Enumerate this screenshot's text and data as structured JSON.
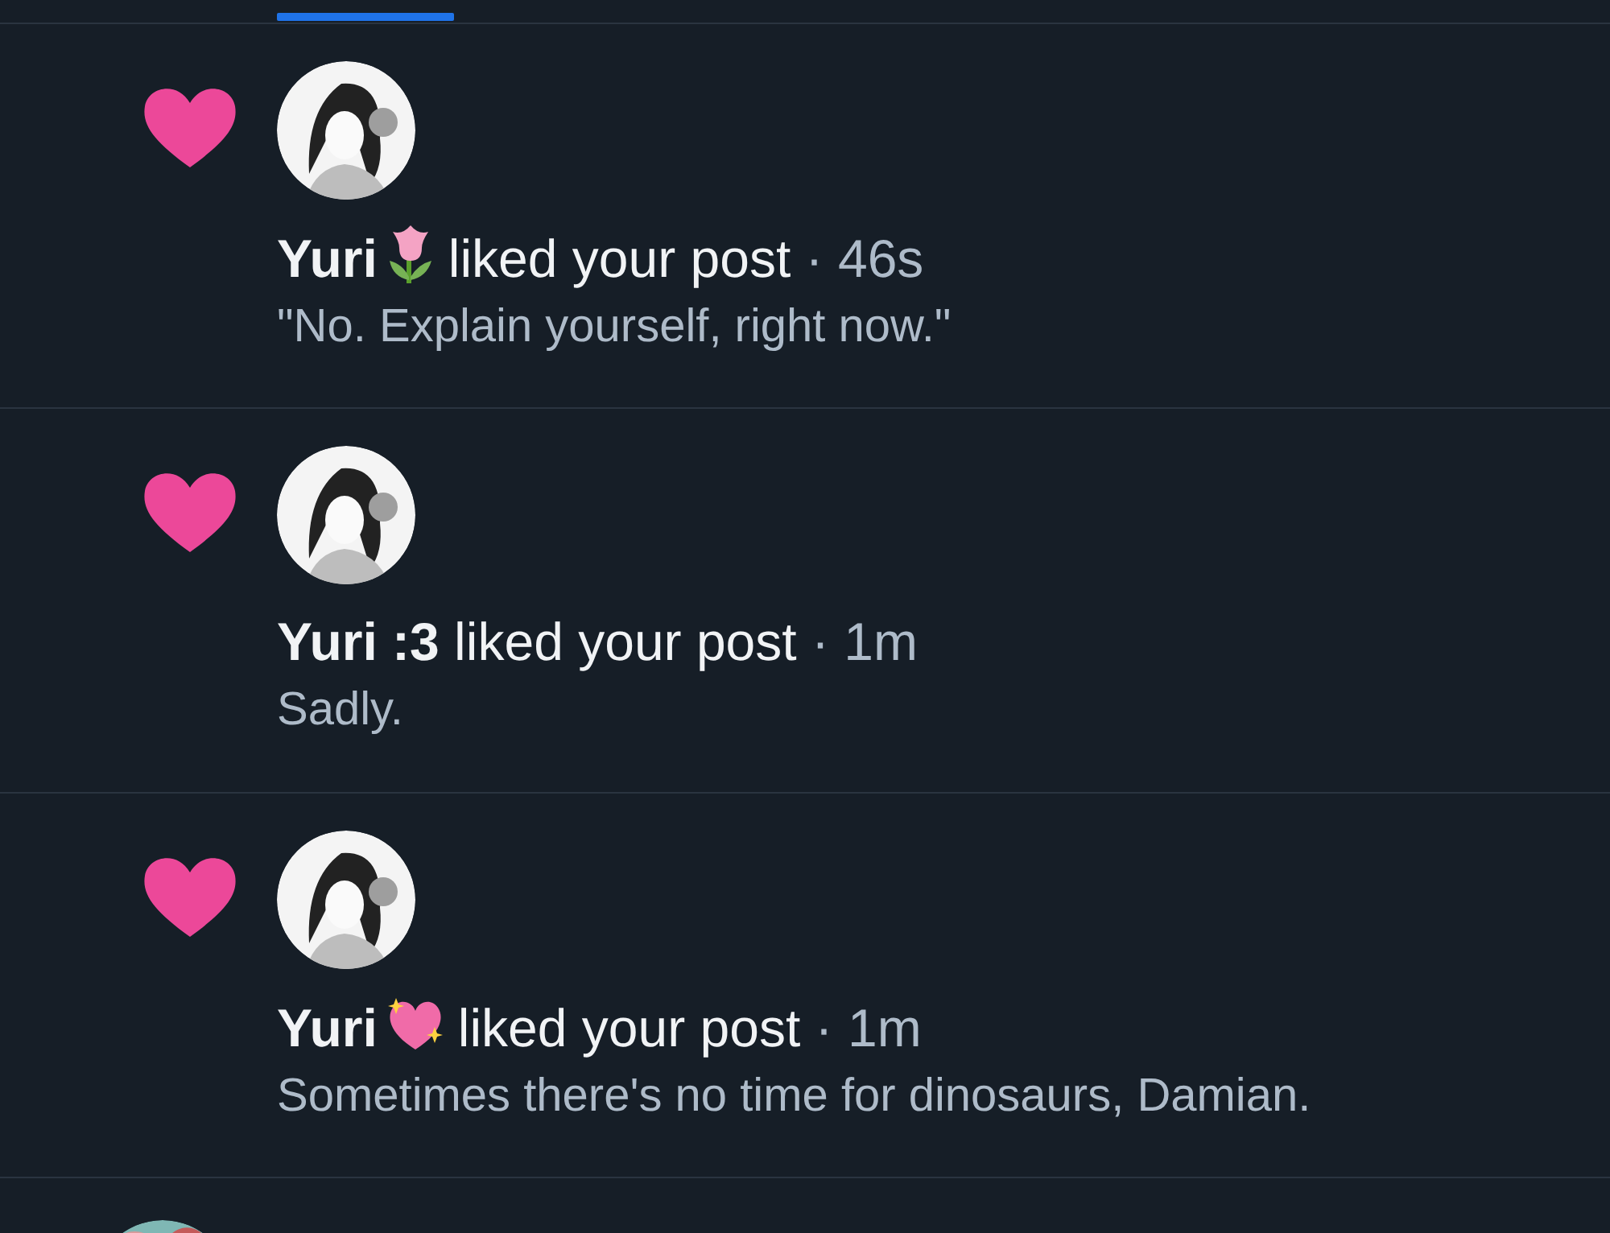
{
  "notifications": [
    {
      "kind": "tulip",
      "author": "Yuri",
      "action": "liked your post",
      "separator": "·",
      "time": "46s",
      "post": "\"No. Explain yourself, right now.\""
    },
    {
      "kind": "plain",
      "author": "Yuri :3",
      "action": "liked your post",
      "separator": "·",
      "time": "1m",
      "post": "Sadly."
    },
    {
      "kind": "sparkle",
      "author": "Yuri",
      "action": "liked your post",
      "separator": "·",
      "time": "1m",
      "post": "Sometimes there's no time for dinosaurs, Damian."
    }
  ]
}
